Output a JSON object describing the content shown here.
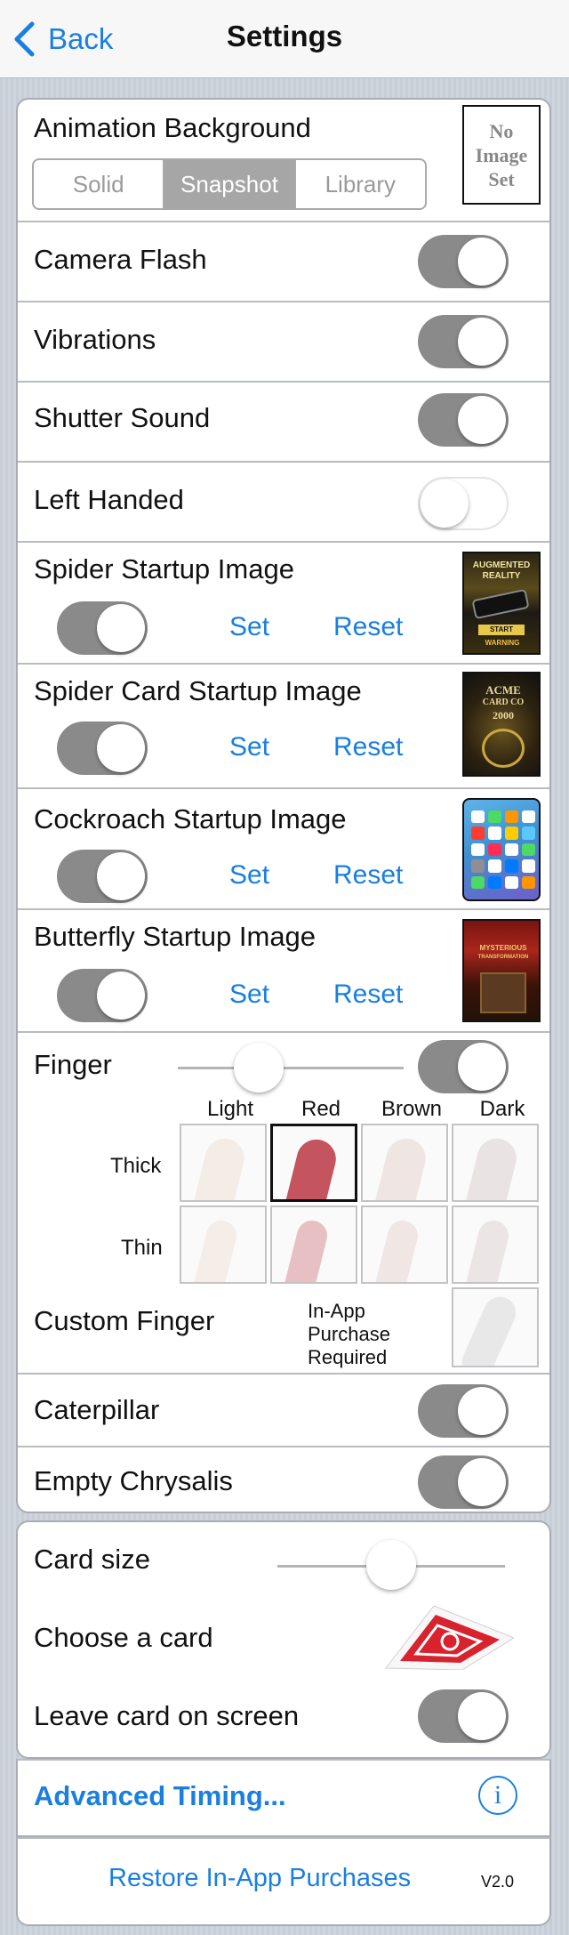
{
  "nav": {
    "back_label": "Back",
    "title": "Settings"
  },
  "animation": {
    "title": "Animation Background",
    "segments": [
      "Solid",
      "Snapshot",
      "Library"
    ],
    "selected_segment": "Snapshot",
    "no_image_lines": [
      "No",
      "Image",
      "Set"
    ]
  },
  "toggles": {
    "camera_flash": {
      "label": "Camera Flash",
      "on": true
    },
    "vibrations": {
      "label": "Vibrations",
      "on": true
    },
    "shutter_sound": {
      "label": "Shutter Sound",
      "on": true
    },
    "left_handed": {
      "label": "Left Handed",
      "on": false
    }
  },
  "startup_images": [
    {
      "label": "Spider Startup Image",
      "set": "Set",
      "reset": "Reset",
      "on": true,
      "thumb_text": [
        "AUGMENTED",
        "REALITY",
        "START",
        "WARNING"
      ]
    },
    {
      "label": "Spider Card Startup Image",
      "set": "Set",
      "reset": "Reset",
      "on": true,
      "thumb_text": [
        "ACME",
        "CARD CO",
        "2000"
      ]
    },
    {
      "label": "Cockroach Startup Image",
      "set": "Set",
      "reset": "Reset",
      "on": true,
      "thumb_text": []
    },
    {
      "label": "Butterfly Startup Image",
      "set": "Set",
      "reset": "Reset",
      "on": true,
      "thumb_text": [
        "MYSTERIOUS",
        "TRANSFORMATION"
      ]
    }
  ],
  "finger": {
    "label": "Finger",
    "on": true,
    "slider_level": 0.36,
    "columns": [
      "Light",
      "Red",
      "Brown",
      "Dark"
    ],
    "rows": [
      "Thick",
      "Thin"
    ],
    "selected": {
      "row": "Thick",
      "column": "Red"
    },
    "colors": {
      "Light": "#efe2d6",
      "Red": "#c4545e",
      "Brown": "#e5d3cd",
      "Dark": "#dccfcf"
    },
    "custom_label": "Custom Finger",
    "iap_lines": [
      "In-App",
      "Purchase",
      "Required"
    ]
  },
  "caterpillar": {
    "label": "Caterpillar",
    "on": true
  },
  "empty_chrysalis": {
    "label": "Empty Chrysalis",
    "on": true
  },
  "card": {
    "size_label": "Card size",
    "size_level": 0.5,
    "choose_label": "Choose a card",
    "leave_label": "Leave card on screen",
    "leave_on": true
  },
  "advanced": {
    "label": "Advanced Timing...",
    "info_icon": "info-icon",
    "info_glyph": "i"
  },
  "footer": {
    "restore_label": "Restore In-App Purchases",
    "version": "V2.0"
  },
  "colors": {
    "accent": "#1a7fe0",
    "toggle_on": "#8a8a8a"
  }
}
